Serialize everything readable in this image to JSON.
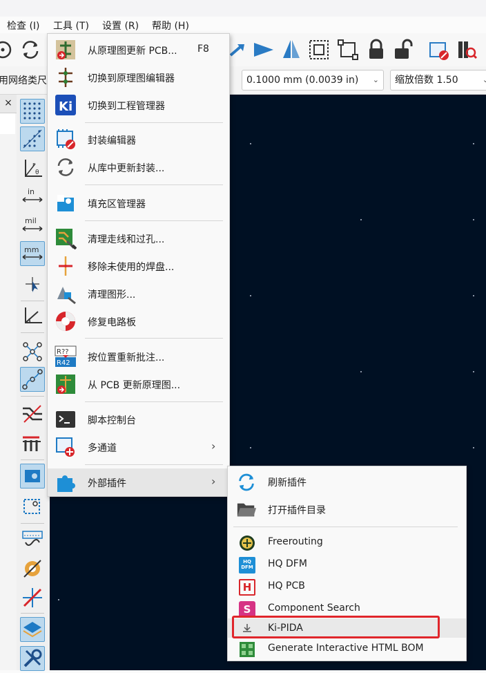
{
  "menubar": {
    "items": [
      "检查 (I)",
      "工具 (T)",
      "设置 (R)",
      "帮助 (H)"
    ]
  },
  "toolbar2": {
    "left_fragment": "用网络类尺",
    "grid_value": "0.1000 mm (0.0039 in)",
    "zoom_value": "缩放倍数 1.50"
  },
  "sidebar": {
    "close_glyph": "×"
  },
  "tools_menu": {
    "items": [
      {
        "label": "从原理图更新 PCB...",
        "shortcut": "F8",
        "icon": "update-pcb-icon"
      },
      {
        "label": "切换到原理图编辑器",
        "icon": "schematic-editor-icon"
      },
      {
        "label": "切换到工程管理器",
        "icon": "kicad-logo-icon"
      },
      {
        "label": "封装编辑器",
        "icon": "footprint-editor-icon"
      },
      {
        "label": "从库中更新封装...",
        "icon": "refresh-icon"
      },
      {
        "label": "填充区管理器",
        "icon": "zone-manager-icon"
      },
      {
        "label": "清理走线和过孔...",
        "icon": "cleanup-tracks-icon"
      },
      {
        "label": "移除未使用的焊盘...",
        "icon": "remove-pads-icon"
      },
      {
        "label": "清理图形...",
        "icon": "cleanup-graphics-icon"
      },
      {
        "label": "修复电路板",
        "icon": "repair-board-icon"
      },
      {
        "label": "按位置重新批注...",
        "icon": "reannotate-icon"
      },
      {
        "label": "从 PCB 更新原理图...",
        "icon": "update-schematic-icon"
      },
      {
        "label": "脚本控制台",
        "icon": "console-icon"
      },
      {
        "label": "多通道",
        "submenu_arrow": "›",
        "icon": "multichannel-icon"
      },
      {
        "label": "外部插件",
        "submenu_arrow": "›",
        "icon": "plugin-puzzle-icon"
      }
    ]
  },
  "plugins_submenu": {
    "items": [
      {
        "label": "刷新插件",
        "icon": "refresh-icon"
      },
      {
        "label": "打开插件目录",
        "icon": "folder-icon"
      },
      {
        "label": "Freerouting",
        "icon": "freerouting-icon"
      },
      {
        "label": "HQ DFM",
        "icon": "hq-dfm-icon",
        "icon_text": "HQ DFM"
      },
      {
        "label": "HQ PCB",
        "icon": "hq-pcb-icon",
        "icon_text": "H"
      },
      {
        "label": "Component Search",
        "icon": "component-search-icon",
        "icon_text": "S"
      },
      {
        "label": "Ki-PIDA",
        "icon": "ki-pida-icon"
      },
      {
        "label": "Generate Interactive HTML BOM",
        "icon": "html-bom-icon"
      }
    ]
  },
  "colors": {
    "canvas": "#001023",
    "highlight_box": "#e0262b",
    "toggle_active": "#bcd9ee"
  }
}
